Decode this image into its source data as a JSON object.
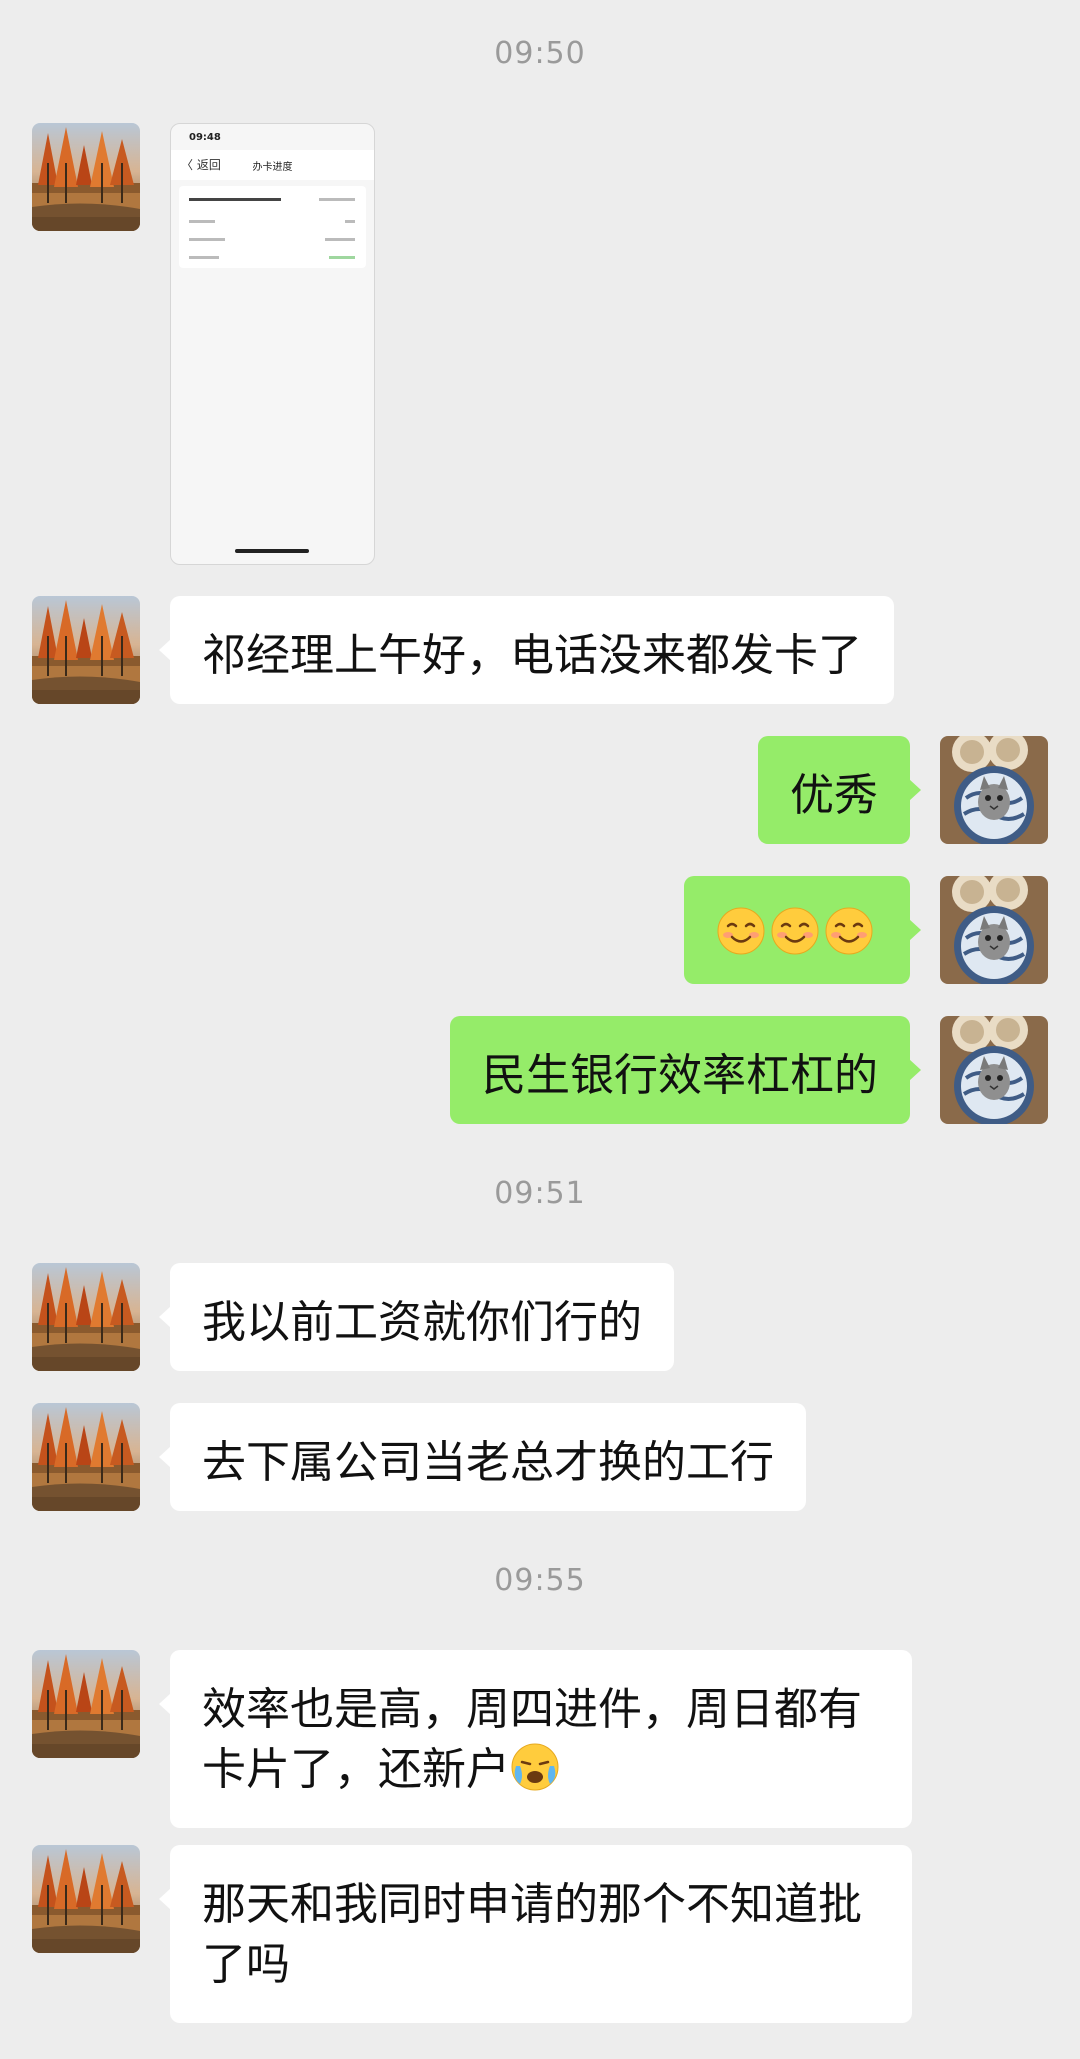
{
  "timestamps": [
    "09:50",
    "09:51",
    "09:55"
  ],
  "screenshot_preview": {
    "status_time": "09:48",
    "back_label": "〈  返回",
    "title": "办卡进度"
  },
  "messages": [
    {
      "side": "in",
      "text": "祁经理上午好，电话没来都发卡了"
    },
    {
      "side": "out",
      "text": "优秀"
    },
    {
      "side": "out",
      "emoji": "😊😊😊"
    },
    {
      "side": "out",
      "text": "民生银行效率杠杠的"
    },
    {
      "side": "in",
      "text": "我以前工资就你们行的"
    },
    {
      "side": "in",
      "text": "去下属公司当老总才换的工行"
    },
    {
      "side": "in",
      "text": "效率也是高，周四进件，周日都有卡片了，还新户",
      "emoji": "😭"
    },
    {
      "side": "in",
      "text": "那天和我同时申请的那个不知道批了吗"
    }
  ],
  "colors": {
    "background": "#ededed",
    "incoming_bubble": "#ffffff",
    "outgoing_bubble": "#95ec69",
    "timestamp_text": "#9a9a9a"
  },
  "icons": {
    "contact_avatar": "autumn-trees-avatar",
    "self_avatar": "cat-avatar"
  }
}
